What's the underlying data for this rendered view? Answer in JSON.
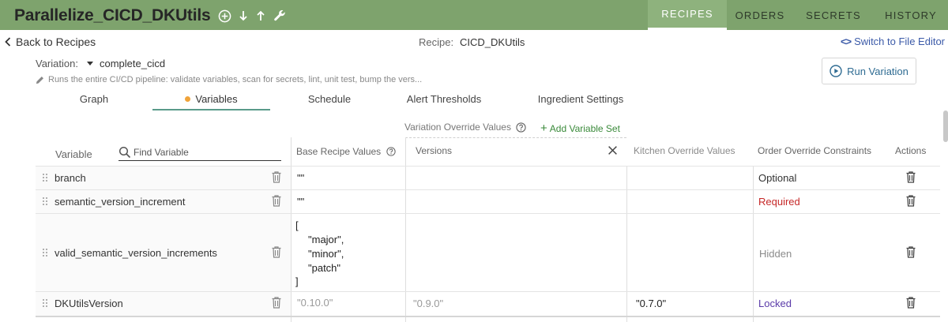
{
  "header": {
    "title": "Parallelize_CICD_DKUtils",
    "nav": [
      {
        "label": "RECIPES",
        "active": true
      },
      {
        "label": "ORDERS",
        "active": false
      },
      {
        "label": "SECRETS",
        "active": false
      },
      {
        "label": "HISTORY",
        "active": false
      }
    ]
  },
  "subheader": {
    "back_label": "Back to Recipes",
    "recipe_label": "Recipe:",
    "recipe_value": "CICD_DKUtils",
    "switch_code": "<>",
    "switch_label": "Switch to File Editor"
  },
  "variation": {
    "label": "Variation:",
    "value": "complete_cicd",
    "description": "Runs the entire CI/CD pipeline: validate variables, scan for secrets, lint, unit test, bump the vers...",
    "run_label": "Run Variation"
  },
  "tabs": [
    {
      "label": "Graph",
      "active": false
    },
    {
      "label": "Variables",
      "active": true
    },
    {
      "label": "Schedule",
      "active": false
    },
    {
      "label": "Alert Thresholds",
      "active": false
    },
    {
      "label": "Ingredient Settings",
      "active": false
    }
  ],
  "table": {
    "override_header": "Variation Override Values",
    "add_variable_set": "Add Variable Set",
    "search_placeholder": "Find Variable",
    "columns": {
      "variable": "Variable",
      "base": "Base Recipe Values",
      "versions": "Versions",
      "kitchen": "Kitchen Override Values",
      "constraints": "Order Override Constraints",
      "actions": "Actions"
    },
    "rows": [
      {
        "name": "branch",
        "base": "\"\"",
        "version": "",
        "kitchen": "",
        "constraint": "Optional"
      },
      {
        "name": "semantic_version_increment",
        "base": "\"\"",
        "version": "",
        "kitchen": "",
        "constraint": "Required"
      },
      {
        "name": "valid_semantic_version_increments",
        "base_lines": [
          "[",
          "\"major\",",
          "\"minor\",",
          "\"patch\"",
          "]"
        ],
        "version": "",
        "kitchen": "",
        "constraint": "Hidden"
      },
      {
        "name": "DKUtilsVersion",
        "base": "\"0.10.0\"",
        "version": "\"0.9.0\"",
        "kitchen": "\"0.7.0\"",
        "constraint": "Locked"
      }
    ]
  },
  "colors": {
    "header_bg": "#7ea36d",
    "active_tab_dot": "#f0a33a",
    "required": "#c62828",
    "locked": "#5a3aa8",
    "add_set": "#3a8a3a"
  }
}
